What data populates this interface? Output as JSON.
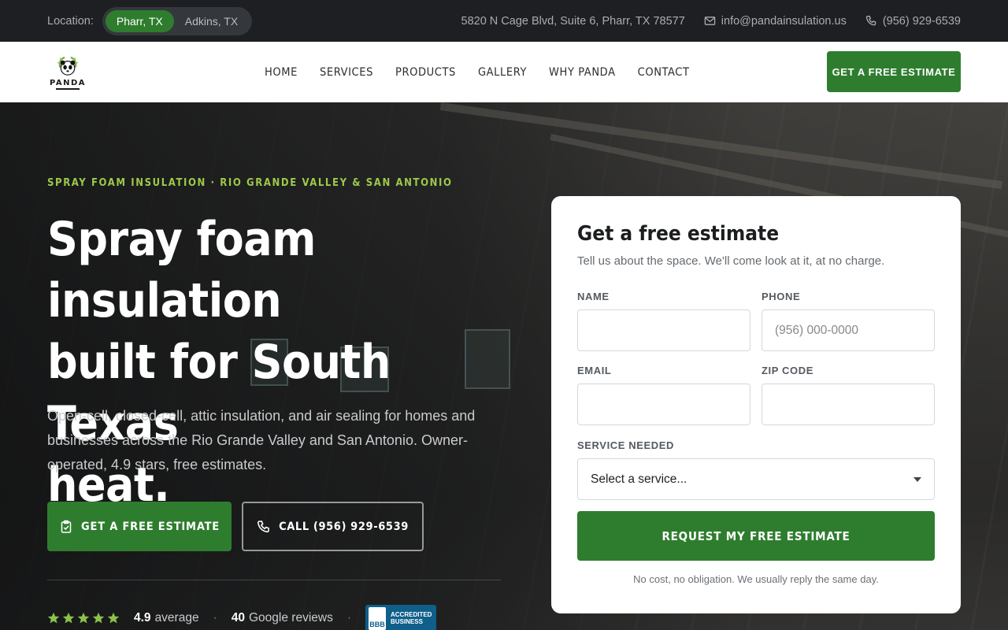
{
  "topbar": {
    "location_label": "Location:",
    "locations": [
      "Pharr, TX",
      "Adkins, TX"
    ],
    "active_location": "Pharr, TX",
    "address": "5820 N Cage Blvd, Suite 6, Pharr, TX 78577",
    "email": "info@pandainsulation.us",
    "phone": "(956) 929-6539"
  },
  "header": {
    "logo_text": "PANDA",
    "nav": [
      "HOME",
      "SERVICES",
      "PRODUCTS",
      "GALLERY",
      "WHY PANDA",
      "CONTACT"
    ],
    "cta_label": "GET A FREE ESTIMATE"
  },
  "hero": {
    "eyebrow": "SPRAY FOAM INSULATION · RIO GRANDE VALLEY & SAN ANTONIO",
    "headline_line1": "Spray foam insulation",
    "headline_line2": "built for South Texas",
    "headline_line3": "heat.",
    "lead": "Open-cell, closed-cell, attic insulation, and air sealing for homes and businesses across the Rio Grande Valley and San Antonio. Owner-operated, 4.9 stars, free estimates.",
    "primary_button": "GET A FREE ESTIMATE",
    "secondary_button": "CALL (956) 929-6539",
    "rating_value": "4.9",
    "rating_suffix": "average",
    "reviews_count": "40",
    "reviews_suffix": "Google reviews",
    "stars": 5,
    "bbb_mark": "BBB",
    "bbb_line1": "ACCREDITED",
    "bbb_line2": "BUSINESS"
  },
  "estimate_form": {
    "title": "Get a free estimate",
    "subtitle": "Tell us about the space. We'll come look at it, at no charge.",
    "name_label": "NAME",
    "name_value": "",
    "phone_label": "PHONE",
    "phone_placeholder": "(956) 000-0000",
    "email_label": "EMAIL",
    "email_value": "",
    "zip_label": "ZIP CODE",
    "zip_value": "",
    "service_label": "SERVICE NEEDED",
    "service_selected": "Select a service...",
    "submit_label": "REQUEST MY FREE ESTIMATE",
    "note": "No cost, no obligation. We usually reply the same day."
  },
  "colors": {
    "brand_green": "#2e7d2e",
    "accent_lime": "#9cc94a",
    "star_color": "#8bc34a",
    "topbar_bg": "#1d1f22"
  }
}
